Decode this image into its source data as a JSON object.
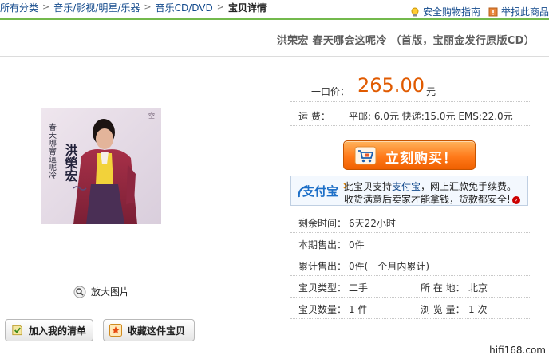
{
  "breadcrumb": [
    "所有分类",
    "音乐/影视/明星/乐器",
    "音乐CD/DVD",
    "宝贝详情"
  ],
  "toplinks": {
    "guide": "安全购物指南",
    "report": "举报此商品"
  },
  "title": "洪荣宏  春天哪会这呢冷  （首版，宝丽金发行原版CD）",
  "cover": {
    "artist": "洪榮宏",
    "album": "春天哪會這呢冷"
  },
  "zoom_label": "放大图片",
  "price": {
    "label": "一口价：",
    "value": "265.00",
    "unit": "元"
  },
  "shipping": {
    "label": "运    费：",
    "value": "平邮: 6.0元 快递:15.0元 EMS:22.0元"
  },
  "buy_label": "立刻购买！",
  "alipay": {
    "logo": "支付宝",
    "line1_pre": "此宝贝支持",
    "line1_link": "支付宝",
    "line1_post": "，网上汇款免手续费。",
    "line2": "收货满意后卖家才能拿钱，货款都安全!"
  },
  "facts": {
    "time_label": "剩余时间：",
    "time_value": "6天22小时",
    "sold_label": "本期售出：",
    "sold_value": "0件",
    "total_label": "累计售出：",
    "total_value": "0件(一个月内累计)",
    "type_label": "宝贝类型：",
    "type_value": "二手",
    "loc_label": "所 在 地：",
    "loc_value": "北京",
    "qty_label": "宝贝数量：",
    "qty_value": "1 件",
    "views_label": "浏 览 量：",
    "views_value": "1 次"
  },
  "buttons": {
    "add_list": "加入我的清单",
    "favorite": "收藏这件宝贝"
  },
  "watermark": "hifi168.com",
  "colors": {
    "price": "#e05a00",
    "link": "#134a8c",
    "accent_green": "#73b94c",
    "buy": "#ff7a1a"
  }
}
